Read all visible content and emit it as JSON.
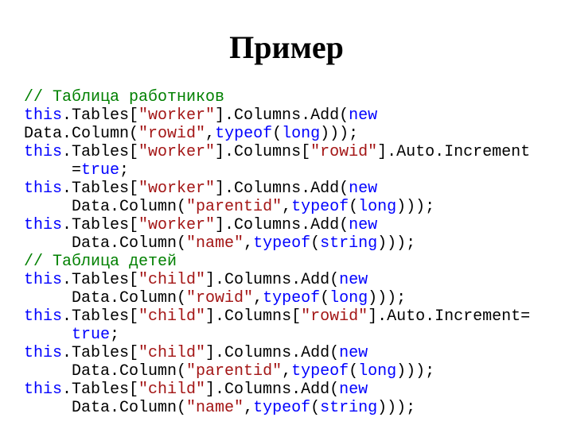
{
  "title": "Пример",
  "lines": [
    [
      {
        "cls": "c-comment",
        "t": "// Таблица работников"
      }
    ],
    [
      {
        "cls": "c-kw",
        "t": "this"
      },
      {
        "t": ".Tables["
      },
      {
        "cls": "c-str",
        "t": "\"worker\""
      },
      {
        "t": "].Columns.Add("
      },
      {
        "cls": "c-kw",
        "t": "new"
      },
      {
        "t": " "
      }
    ],
    [
      {
        "t": "Data.Column("
      },
      {
        "cls": "c-str",
        "t": "\"rowid\""
      },
      {
        "t": ","
      },
      {
        "cls": "c-kw",
        "t": "typeof"
      },
      {
        "t": "("
      },
      {
        "cls": "c-kw",
        "t": "long"
      },
      {
        "t": ")));"
      }
    ],
    [
      {
        "cls": "c-kw",
        "t": "this"
      },
      {
        "t": ".Tables["
      },
      {
        "cls": "c-str",
        "t": "\"worker\""
      },
      {
        "t": "].Columns["
      },
      {
        "cls": "c-str",
        "t": "\"rowid\""
      },
      {
        "t": "].Auto.Increment"
      }
    ],
    [
      {
        "t": "     ="
      },
      {
        "cls": "c-kw",
        "t": "true"
      },
      {
        "t": ";"
      }
    ],
    [
      {
        "cls": "c-kw",
        "t": "this"
      },
      {
        "t": ".Tables["
      },
      {
        "cls": "c-str",
        "t": "\"worker\""
      },
      {
        "t": "].Columns.Add("
      },
      {
        "cls": "c-kw",
        "t": "new"
      },
      {
        "t": " "
      }
    ],
    [
      {
        "t": "     Data.Column("
      },
      {
        "cls": "c-str",
        "t": "\"parentid\""
      },
      {
        "t": ","
      },
      {
        "cls": "c-kw",
        "t": "typeof"
      },
      {
        "t": "("
      },
      {
        "cls": "c-kw",
        "t": "long"
      },
      {
        "t": ")));"
      }
    ],
    [
      {
        "cls": "c-kw",
        "t": "this"
      },
      {
        "t": ".Tables["
      },
      {
        "cls": "c-str",
        "t": "\"worker\""
      },
      {
        "t": "].Columns.Add("
      },
      {
        "cls": "c-kw",
        "t": "new"
      },
      {
        "t": " "
      }
    ],
    [
      {
        "t": "     Data.Column("
      },
      {
        "cls": "c-str",
        "t": "\"name\""
      },
      {
        "t": ","
      },
      {
        "cls": "c-kw",
        "t": "typeof"
      },
      {
        "t": "("
      },
      {
        "cls": "c-kw",
        "t": "string"
      },
      {
        "t": ")));"
      }
    ],
    [
      {
        "cls": "c-comment",
        "t": "// Таблица детей"
      }
    ],
    [
      {
        "cls": "c-kw",
        "t": "this"
      },
      {
        "t": ".Tables["
      },
      {
        "cls": "c-str",
        "t": "\"child\""
      },
      {
        "t": "].Columns.Add("
      },
      {
        "cls": "c-kw",
        "t": "new"
      },
      {
        "t": " "
      }
    ],
    [
      {
        "t": "     Data.Column("
      },
      {
        "cls": "c-str",
        "t": "\"rowid\""
      },
      {
        "t": ","
      },
      {
        "cls": "c-kw",
        "t": "typeof"
      },
      {
        "t": "("
      },
      {
        "cls": "c-kw",
        "t": "long"
      },
      {
        "t": ")));"
      }
    ],
    [
      {
        "cls": "c-kw",
        "t": "this"
      },
      {
        "t": ".Tables["
      },
      {
        "cls": "c-str",
        "t": "\"child\""
      },
      {
        "t": "].Columns["
      },
      {
        "cls": "c-str",
        "t": "\"rowid\""
      },
      {
        "t": "].Auto.Increment="
      }
    ],
    [
      {
        "t": "     "
      },
      {
        "cls": "c-kw",
        "t": "true"
      },
      {
        "t": ";"
      }
    ],
    [
      {
        "cls": "c-kw",
        "t": "this"
      },
      {
        "t": ".Tables["
      },
      {
        "cls": "c-str",
        "t": "\"child\""
      },
      {
        "t": "].Columns.Add("
      },
      {
        "cls": "c-kw",
        "t": "new"
      },
      {
        "t": " "
      }
    ],
    [
      {
        "t": "     Data.Column("
      },
      {
        "cls": "c-str",
        "t": "\"parentid\""
      },
      {
        "t": ","
      },
      {
        "cls": "c-kw",
        "t": "typeof"
      },
      {
        "t": "("
      },
      {
        "cls": "c-kw",
        "t": "long"
      },
      {
        "t": ")));"
      }
    ],
    [
      {
        "cls": "c-kw",
        "t": "this"
      },
      {
        "t": ".Tables["
      },
      {
        "cls": "c-str",
        "t": "\"child\""
      },
      {
        "t": "].Columns.Add("
      },
      {
        "cls": "c-kw",
        "t": "new"
      },
      {
        "t": " "
      }
    ],
    [
      {
        "t": "     Data.Column("
      },
      {
        "cls": "c-str",
        "t": "\"name\""
      },
      {
        "t": ","
      },
      {
        "cls": "c-kw",
        "t": "typeof"
      },
      {
        "t": "("
      },
      {
        "cls": "c-kw",
        "t": "string"
      },
      {
        "t": ")));"
      }
    ]
  ]
}
